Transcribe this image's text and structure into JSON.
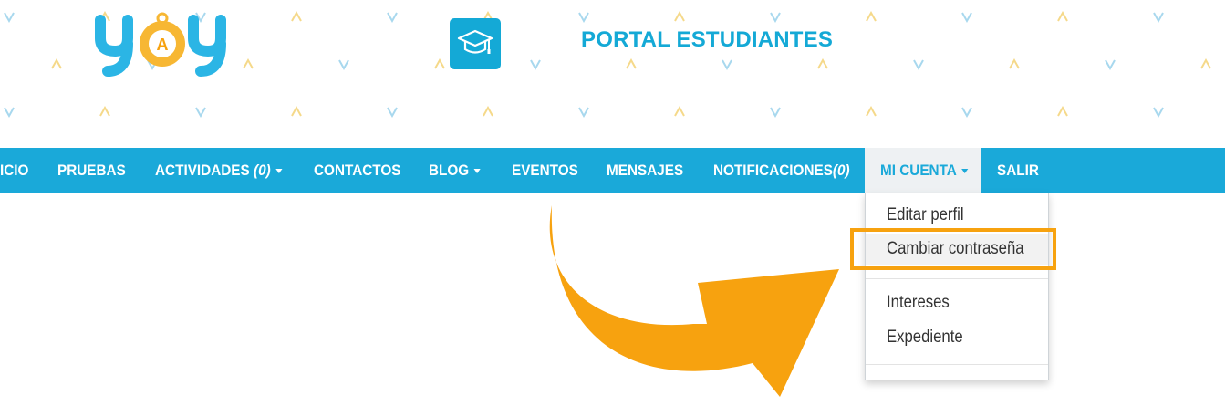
{
  "header": {
    "portal_title": "PORTAL ESTUDIANTES",
    "logo_text": "YOY",
    "portal_icon": "graduation-cap-icon"
  },
  "colors": {
    "brand_blue": "#1aa9d9",
    "accent_orange": "#f7a20f",
    "logo_blue": "#2bb5e5",
    "pattern_yellow": "#f5d98a"
  },
  "nav": {
    "items": [
      {
        "label": "ICIO"
      },
      {
        "label": "PRUEBAS"
      },
      {
        "label": "ACTIVIDADES ",
        "count": "(0)",
        "dropdown": true
      },
      {
        "label": "CONTACTOS"
      },
      {
        "label": "BLOG",
        "dropdown": true
      },
      {
        "label": "EVENTOS"
      },
      {
        "label": "MENSAJES"
      },
      {
        "label": "NOTIFICACIONES",
        "count": "(0)"
      },
      {
        "label": "MI CUENTA",
        "dropdown": true,
        "active": true
      },
      {
        "label": "SALIR"
      }
    ]
  },
  "dropdown": {
    "items": [
      {
        "label": "Editar perfil"
      },
      {
        "label": "Cambiar contraseña",
        "highlighted": true
      },
      {
        "label": "Intereses"
      },
      {
        "label": "Expediente"
      }
    ]
  }
}
